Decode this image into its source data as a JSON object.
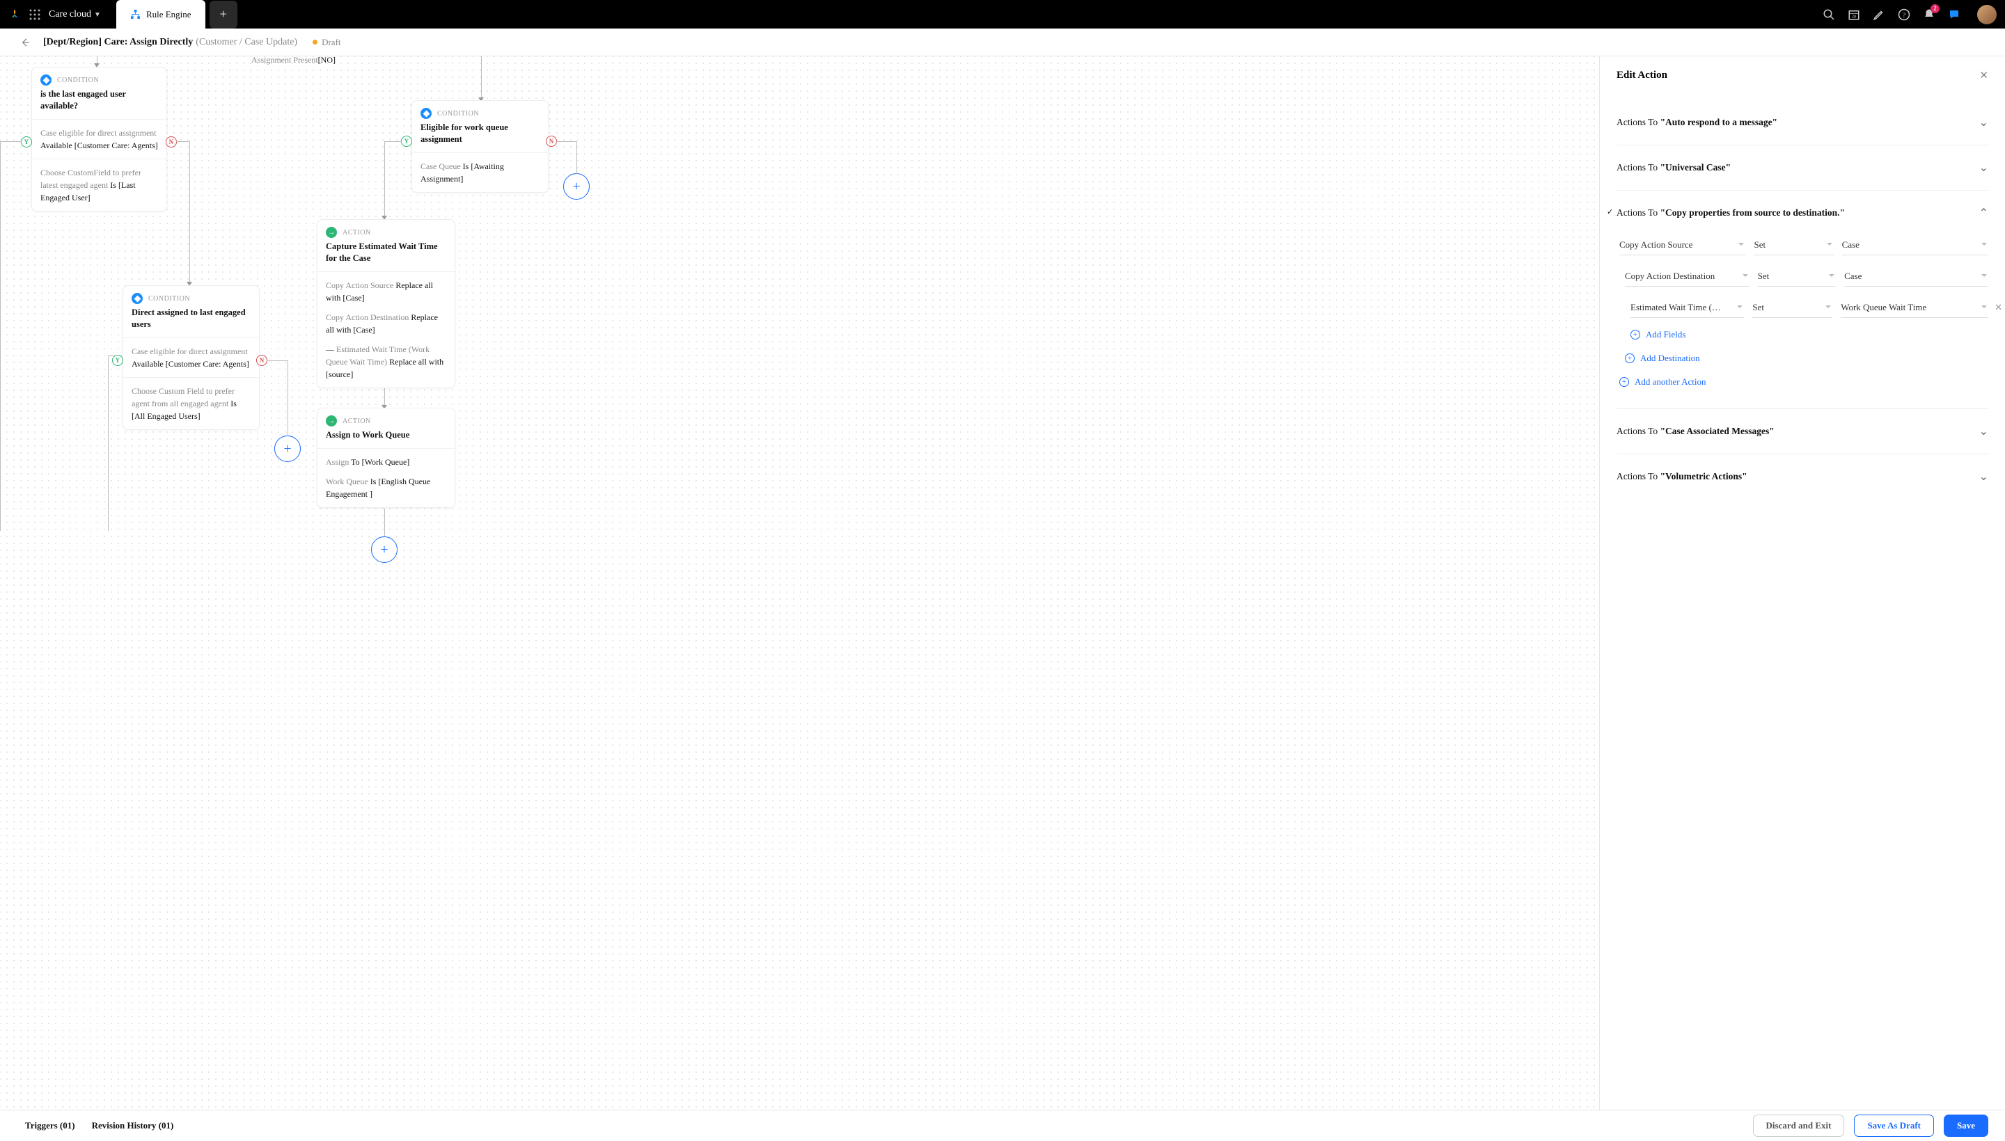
{
  "topbar": {
    "workspace": "Care cloud",
    "tab": "Rule Engine",
    "notification_count": "2"
  },
  "header": {
    "title": "[Dept/Region] Care: Assign Directly",
    "subtitle": "(Customer / Case Update)",
    "status": "Draft"
  },
  "canvas": {
    "stub": "Assignment Present[NO]",
    "n1": {
      "type": "CONDITION",
      "title": "is the last engaged user available?",
      "b1_a": "Case eligible for direct assignment ",
      "b1_b": "Available [Customer Care: Agents]",
      "b2_a": "Choose CustomField to prefer latest engaged agent ",
      "b2_b": "Is [Last Engaged User]"
    },
    "n2": {
      "type": "CONDITION",
      "title": "Eligible for work queue assignment",
      "b1_a": "Case Queue ",
      "b1_b": "Is [Awaiting Assignment]"
    },
    "n3": {
      "type": "CONDITION",
      "title": "Direct assigned to last engaged users",
      "b1_a": "Case eligible for direct assignment ",
      "b1_b": "Available [Customer Care: Agents]",
      "b2_a": "Choose Custom Field to prefer agent from all engaged agent ",
      "b2_b": "Is [All Engaged Users]"
    },
    "n4": {
      "type": "ACTION",
      "title": "Capture Estimated Wait Time for the Case",
      "b1_a": "Copy Action Source ",
      "b1_b": "Replace all with [Case]",
      "b2_a": "Copy Action Destination ",
      "b2_b": "Replace all with [Case]",
      "b3_a": "— ",
      "b3_b": "Estimated Wait Time (Work Queue Wait Time) ",
      "b3_c": "Replace all with [source]"
    },
    "n5": {
      "type": "ACTION",
      "title": "Assign to Work Queue",
      "b1_a": "Assign ",
      "b1_b": "To [Work Queue]",
      "b2_a": "Work Queue ",
      "b2_b": "Is [English Queue Engagement ]"
    }
  },
  "panel": {
    "title": "Edit Action",
    "sections": {
      "s1": {
        "pre": "Actions To ",
        "q": "\"Auto respond to a message\""
      },
      "s2": {
        "pre": "Actions To ",
        "q": "\"Universal Case\""
      },
      "s3": {
        "pre": "Actions To ",
        "q": "\"Copy properties from source to destination.\""
      },
      "s4": {
        "pre": "Actions To ",
        "q": "\"Case Associated Messages\""
      },
      "s5": {
        "pre": "Actions To ",
        "q": "\"Volumetric Actions\""
      }
    },
    "fields": {
      "r1": {
        "f1": "Copy Action Source",
        "f2": "Set",
        "f3": "Case"
      },
      "r2": {
        "f1": "Copy Action Destination",
        "f2": "Set",
        "f3": "Case"
      },
      "r3": {
        "f1": "Estimated Wait Time (…",
        "f2": "Set",
        "f3": "Work Queue Wait Time"
      }
    },
    "add_fields": "Add Fields",
    "add_dest": "Add Destination",
    "add_action": "Add another Action"
  },
  "footer": {
    "triggers": "Triggers (01)",
    "revision": "Revision History (01)",
    "discard": "Discard and Exit",
    "save_draft": "Save As Draft",
    "save": "Save"
  }
}
